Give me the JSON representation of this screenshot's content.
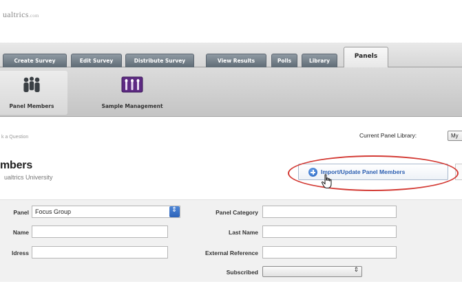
{
  "app": {
    "logo_text": "ualtrics",
    "logo_tld": ".com"
  },
  "tabs": [
    {
      "label": "Create Survey"
    },
    {
      "label": "Edit Survey"
    },
    {
      "label": "Distribute Survey"
    },
    {
      "label": "View Results"
    },
    {
      "label": "Polls"
    },
    {
      "label": "Library"
    },
    {
      "label": "Panels",
      "active": true
    }
  ],
  "toolbar": {
    "items": [
      {
        "label": "Panel Members",
        "icon": "people-icon",
        "selected": true
      },
      {
        "label": "Sample Management",
        "icon": "sample-management-icon",
        "selected": false
      }
    ]
  },
  "helper_text": "k a Question",
  "library": {
    "label": "Current Panel Library:",
    "value": "My"
  },
  "page": {
    "title": "mbers",
    "subtitle": "ualtrics University"
  },
  "import_button": {
    "label": "Import/Update Panel Members"
  },
  "form": {
    "panel": {
      "label": "Panel",
      "value": "Focus Group"
    },
    "name": {
      "label": "Name",
      "value": ""
    },
    "address": {
      "label": "ldress",
      "value": ""
    },
    "panel_category": {
      "label": "Panel Category",
      "value": ""
    },
    "last_name": {
      "label": "Last Name",
      "value": ""
    },
    "external_reference": {
      "label": "External Reference",
      "value": ""
    },
    "subscribed": {
      "label": "Subscribed",
      "value": ""
    }
  },
  "colors": {
    "accent_blue": "#2a5db0",
    "highlight_red": "#d33a34",
    "tab_gray": "#6b7680"
  }
}
